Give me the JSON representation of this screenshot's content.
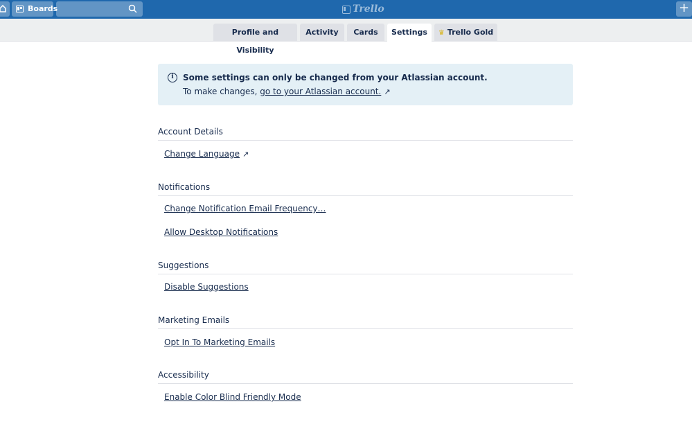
{
  "header": {
    "boards_label": "Boards",
    "search_placeholder": "",
    "logo_text": "Trello",
    "add_label": "+"
  },
  "tabs": [
    {
      "label": "Profile and Visibility"
    },
    {
      "label": "Activity"
    },
    {
      "label": "Cards"
    },
    {
      "label": "Settings",
      "active": true
    },
    {
      "label": "Trello Gold"
    }
  ],
  "notice": {
    "title": "Some settings can only be changed from your Atlassian account.",
    "prefix": "To make changes,",
    "link": "go to your Atlassian account.",
    "ext_icon": "↗"
  },
  "sections": {
    "account": {
      "title": "Account Details",
      "links": [
        "Change Language"
      ]
    },
    "notifications": {
      "title": "Notifications",
      "links": [
        "Change Notification Email Frequency…",
        "Allow Desktop Notifications"
      ]
    },
    "suggestions": {
      "title": "Suggestions",
      "links": [
        "Disable Suggestions"
      ]
    },
    "marketing": {
      "title": "Marketing Emails",
      "links": [
        "Opt In To Marketing Emails"
      ]
    },
    "accessibility": {
      "title": "Accessibility",
      "links": [
        "Enable Color Blind Friendly Mode"
      ]
    }
  },
  "colors": {
    "header_bg": "#1f68ad",
    "notice_bg": "#e4f0f6",
    "text": "#172b4d"
  }
}
